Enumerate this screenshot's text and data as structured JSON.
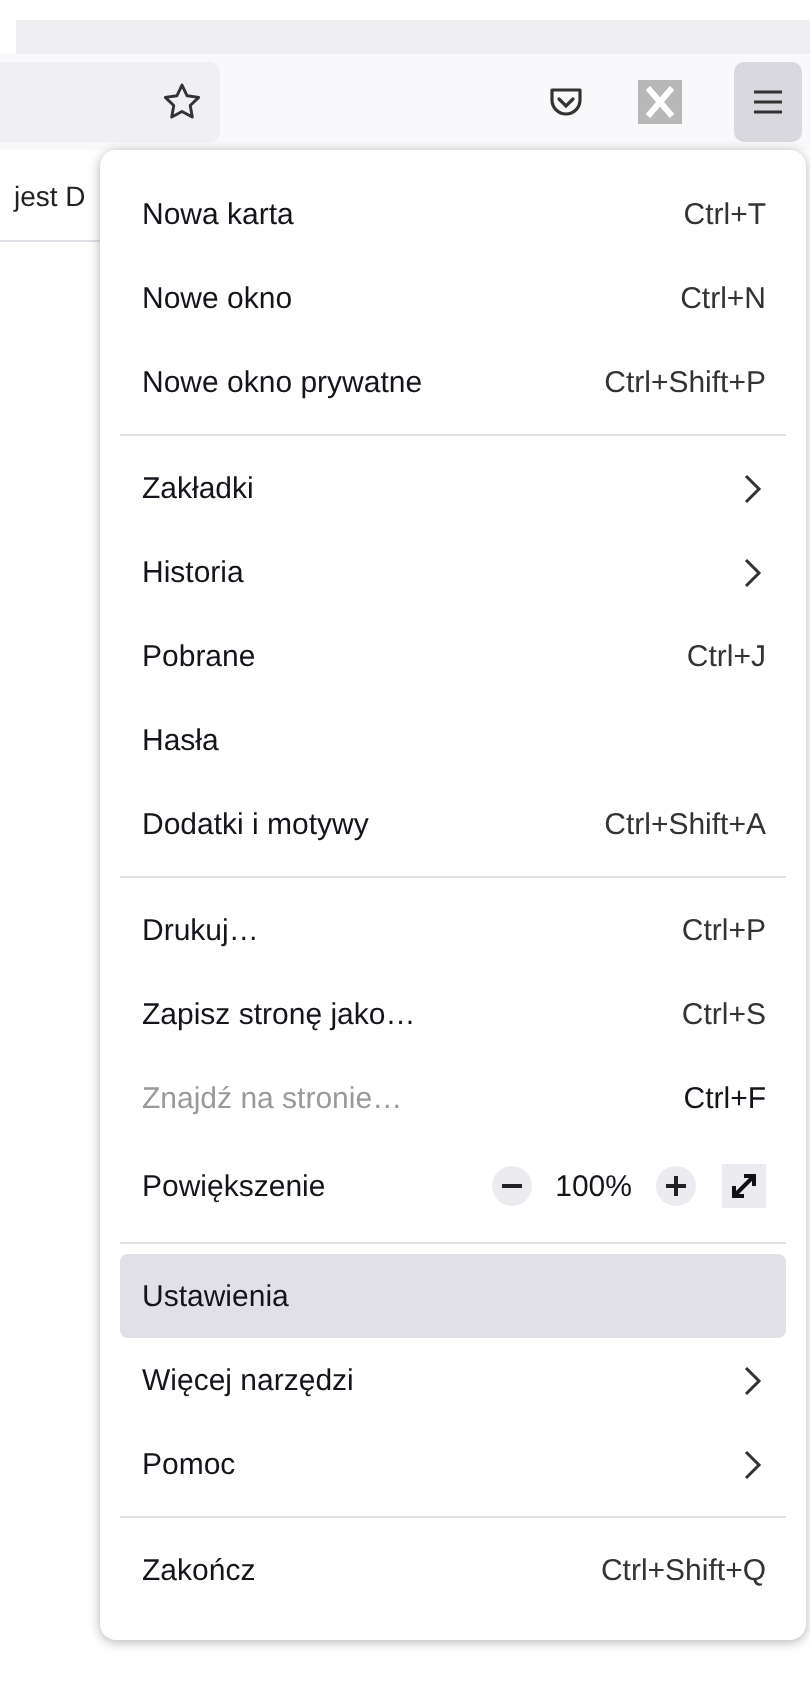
{
  "bookmarks_bar": {
    "partial_text": "jest D"
  },
  "menu": {
    "sections": [
      [
        {
          "kind": "item",
          "label": "Nowa karta",
          "shortcut": "Ctrl+T",
          "disabled": false,
          "highlighted": false
        },
        {
          "kind": "item",
          "label": "Nowe okno",
          "shortcut": "Ctrl+N",
          "disabled": false,
          "highlighted": false
        },
        {
          "kind": "item",
          "label": "Nowe okno prywatne",
          "shortcut": "Ctrl+Shift+P",
          "disabled": false,
          "highlighted": false
        }
      ],
      [
        {
          "kind": "submenu",
          "label": "Zakładki",
          "disabled": false,
          "highlighted": false
        },
        {
          "kind": "submenu",
          "label": "Historia",
          "disabled": false,
          "highlighted": false
        },
        {
          "kind": "item",
          "label": "Pobrane",
          "shortcut": "Ctrl+J",
          "disabled": false,
          "highlighted": false
        },
        {
          "kind": "item",
          "label": "Hasła",
          "disabled": false,
          "highlighted": false
        },
        {
          "kind": "item",
          "label": "Dodatki i motywy",
          "shortcut": "Ctrl+Shift+A",
          "disabled": false,
          "highlighted": false
        }
      ],
      [
        {
          "kind": "item",
          "label": "Drukuj…",
          "shortcut": "Ctrl+P",
          "disabled": false,
          "highlighted": false
        },
        {
          "kind": "item",
          "label": "Zapisz stronę jako…",
          "shortcut": "Ctrl+S",
          "disabled": false,
          "highlighted": false
        },
        {
          "kind": "item",
          "label": "Znajdź na stronie…",
          "shortcut": "Ctrl+F",
          "disabled": true,
          "highlighted": false
        },
        {
          "kind": "zoom",
          "label": "Powiększenie",
          "value": "100%",
          "disabled": false,
          "highlighted": false
        }
      ],
      [
        {
          "kind": "item",
          "label": "Ustawienia",
          "disabled": false,
          "highlighted": true
        },
        {
          "kind": "submenu",
          "label": "Więcej narzędzi",
          "disabled": false,
          "highlighted": false
        },
        {
          "kind": "submenu",
          "label": "Pomoc",
          "disabled": false,
          "highlighted": false
        }
      ],
      [
        {
          "kind": "item",
          "label": "Zakończ",
          "shortcut": "Ctrl+Shift+Q",
          "disabled": false,
          "highlighted": false
        }
      ]
    ]
  }
}
